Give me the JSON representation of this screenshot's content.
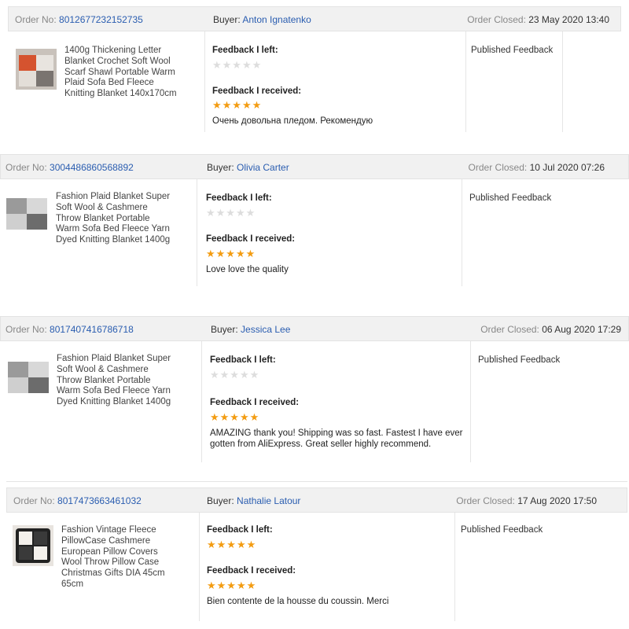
{
  "labels": {
    "order_no": "Order No:",
    "buyer": "Buyer:",
    "order_closed": "Order Closed:",
    "feedback_left": "Feedback I left:",
    "feedback_received": "Feedback I received:",
    "published": "Published Feedback"
  },
  "colors": {
    "link": "#2a5db0",
    "star_full": "#f39c12",
    "star_empty": "#dddddd",
    "header_bg": "#f1f1f1"
  },
  "orders": [
    {
      "order_no": "8012677232152735",
      "buyer": "Anton Ignatenko",
      "closed": "23 May 2020 13:40",
      "product": "1400g Thickening Letter Blanket Crochet Soft Wool Scarf Shawl Portable Warm Plaid Sofa Bed Fleece Knitting Blanket 140x170cm",
      "left_stars": "★★★★★",
      "received_stars": "★★★★★",
      "comment": "Очень довольна пледом. Рекомендую"
    },
    {
      "order_no": "3004486860568892",
      "buyer": "Olivia Carter",
      "closed": "10 Jul 2020 07:26",
      "product": "Fashion Plaid Blanket Super Soft Wool & Cashmere Throw Blanket Portable Warm Sofa Bed Fleece Yarn Dyed Knitting Blanket 1400g",
      "left_stars": "★★★★★",
      "received_stars": "★★★★★",
      "comment": "Love love the quality"
    },
    {
      "order_no": "8017407416786718",
      "buyer": "Jessica Lee",
      "closed": "06 Aug 2020 17:29",
      "product": "Fashion Plaid Blanket Super Soft Wool & Cashmere Throw Blanket Portable Warm Sofa Bed Fleece Yarn Dyed Knitting Blanket 1400g",
      "left_stars": "★★★★★",
      "received_stars": "★★★★★",
      "comment": "AMAZING thank you! Shipping was so fast. Fastest I have ever gotten from AliExpress. Great seller highly recommend."
    },
    {
      "order_no": "8017473663461032",
      "buyer": "Nathalie Latour",
      "closed": "17 Aug 2020 17:50",
      "product": "Fashion Vintage Fleece PillowCase Cashmere European Pillow Covers Wool Throw Pillow Case Christmas Gifts DIA 45cm 65cm",
      "left_stars": "★★★★★",
      "received_stars": "★★★★★",
      "comment": "Bien contente de la housse du coussin. Merci"
    }
  ]
}
